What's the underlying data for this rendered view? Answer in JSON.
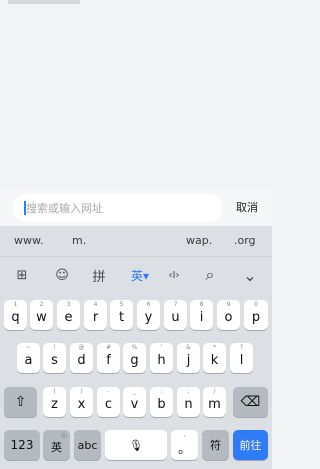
{
  "search": {
    "placeholder": "搜索或输入网址",
    "cancel_label": "取消"
  },
  "suggestions": [
    "www.",
    "m.",
    "wap.",
    ".org"
  ],
  "toolbar": {
    "items": [
      {
        "name": "grid-icon",
        "glyph": "⊞"
      },
      {
        "name": "emoji-icon",
        "glyph": "☺"
      },
      {
        "name": "pinyin-label",
        "glyph": "拼"
      },
      {
        "name": "english-label",
        "glyph": "英▾"
      },
      {
        "name": "cursor-move-icon",
        "glyph": "‹I›"
      },
      {
        "name": "search-icon",
        "glyph": "⌕"
      },
      {
        "name": "collapse-icon",
        "glyph": "⌄"
      }
    ]
  },
  "keyboard": {
    "row1": [
      {
        "main": "q",
        "sub": "1"
      },
      {
        "main": "w",
        "sub": "2"
      },
      {
        "main": "e",
        "sub": "3"
      },
      {
        "main": "r",
        "sub": "4"
      },
      {
        "main": "t",
        "sub": "5"
      },
      {
        "main": "y",
        "sub": "6"
      },
      {
        "main": "u",
        "sub": "7"
      },
      {
        "main": "i",
        "sub": "8"
      },
      {
        "main": "o",
        "sub": "9"
      },
      {
        "main": "p",
        "sub": "0"
      }
    ],
    "row2": [
      {
        "main": "a",
        "sub": "~"
      },
      {
        "main": "s",
        "sub": "!"
      },
      {
        "main": "d",
        "sub": "@"
      },
      {
        "main": "f",
        "sub": "#"
      },
      {
        "main": "g",
        "sub": "%"
      },
      {
        "main": "h",
        "sub": "'"
      },
      {
        "main": "j",
        "sub": "&"
      },
      {
        "main": "k",
        "sub": "*"
      },
      {
        "main": "l",
        "sub": "?"
      }
    ],
    "row3": [
      {
        "main": "z",
        "sub": "("
      },
      {
        "main": "x",
        "sub": ")"
      },
      {
        "main": "c",
        "sub": "-"
      },
      {
        "main": "v",
        "sub": "_"
      },
      {
        "main": "b",
        "sub": ":"
      },
      {
        "main": "n",
        "sub": ";"
      },
      {
        "main": "m",
        "sub": "/"
      }
    ],
    "shift_glyph": "⇧",
    "delete_glyph": "⌫",
    "num_label": "123",
    "lang_label": "英",
    "lang_sub": "中",
    "abc_label": "abc",
    "mic_glyph": "🎙",
    "dot_label": "。",
    "dot_sub": ",",
    "symbol_label": "符",
    "go_label": "前往"
  }
}
